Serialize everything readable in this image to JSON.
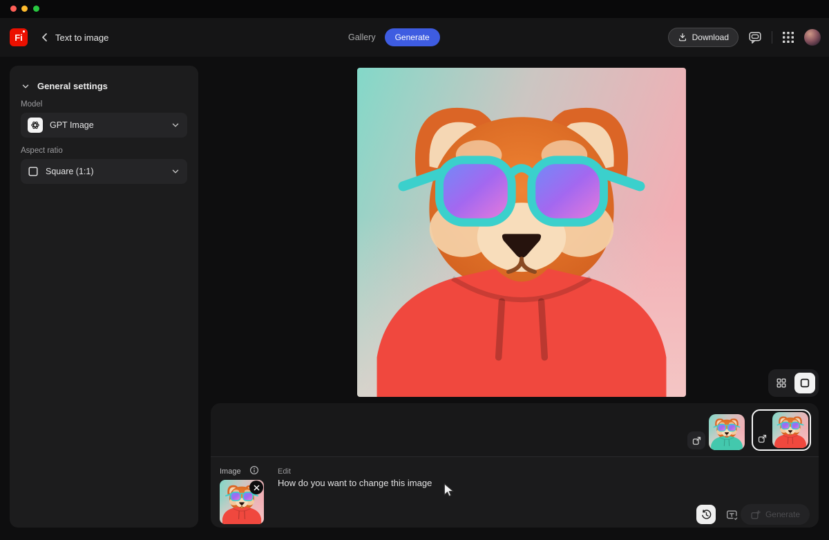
{
  "colors": {
    "accent_blue": "#3e5ce1",
    "brand_red": "#eb1000",
    "glasses_teal": "#3bd0cc",
    "hoodie_red": "#f0483e",
    "hoodie_teal": "#43c8ad",
    "selected_border": "#f7f7f7"
  },
  "header": {
    "logo_text": "Fi",
    "title": "Text to image",
    "gallery_label": "Gallery",
    "generate_label": "Generate",
    "download_label": "Download"
  },
  "sidebar": {
    "section_title": "General settings",
    "model_label": "Model",
    "model_value": "GPT Image",
    "aspect_label": "Aspect ratio",
    "aspect_value": "Square (1:1)"
  },
  "canvas": {
    "image_alt": "3D red panda wearing teal sunglasses and a red hoodie on a teal-to-pink gradient background"
  },
  "filmstrip": {
    "items": [
      {
        "variant": "teal-hoodie",
        "selected": false
      },
      {
        "variant": "red-hoodie",
        "selected": true
      }
    ]
  },
  "composer": {
    "image_label": "Image",
    "edit_label": "Edit",
    "prompt_text": "How do you want to change this image",
    "generate_label": "Generate"
  }
}
